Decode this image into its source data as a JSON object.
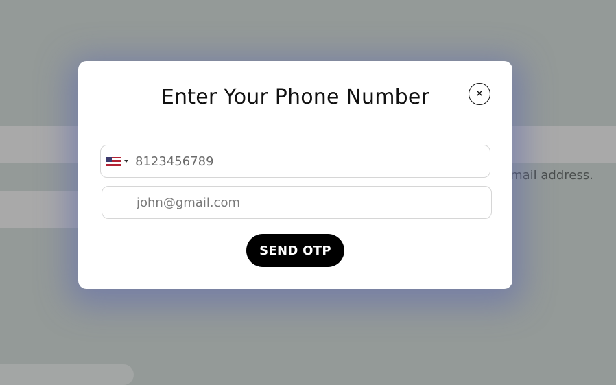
{
  "background": {
    "hint_text": "email address."
  },
  "modal": {
    "title": "Enter Your Phone Number",
    "close_icon": "close-icon",
    "phone": {
      "country": "US",
      "flag_icon": "us-flag-icon",
      "value": "8123456789",
      "placeholder": ""
    },
    "email": {
      "value": "",
      "placeholder": "john@gmail.com"
    },
    "send_button_label": "SEND OTP"
  },
  "colors": {
    "overlay": "#949a98",
    "modal_bg": "#ffffff",
    "button_bg": "#000000",
    "button_text": "#ffffff",
    "modal_glow": "#5f69af"
  }
}
